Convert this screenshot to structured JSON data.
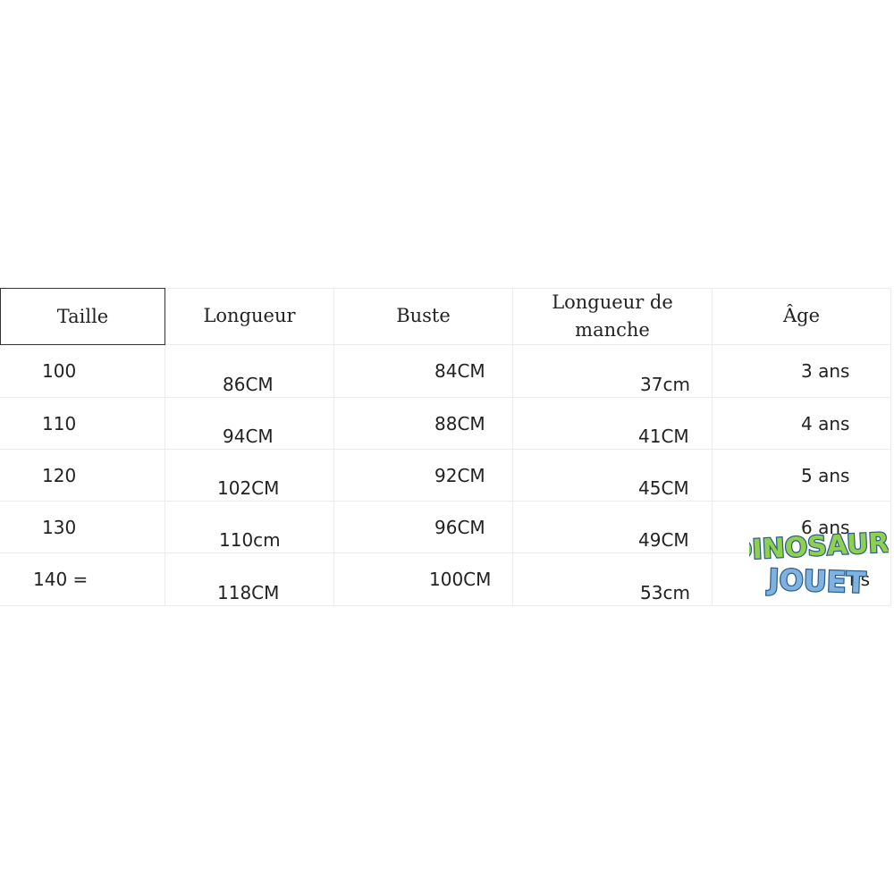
{
  "table": {
    "headers": {
      "taille": "Taille",
      "longueur": "Longueur",
      "buste": "Buste",
      "manche_line1": "Longueur de",
      "manche_line2": "manche",
      "age": "Âge"
    },
    "rows": [
      {
        "taille": "100",
        "longueur": "86CM",
        "buste": "84CM",
        "manche": "37cm",
        "age": "3 ans"
      },
      {
        "taille": "110",
        "longueur": "94CM",
        "buste": "88CM",
        "manche": "41CM",
        "age": "4 ans"
      },
      {
        "taille": "120",
        "longueur": "102CM",
        "buste": "92CM",
        "manche": "45CM",
        "age": "5 ans"
      },
      {
        "taille": "130",
        "longueur": "110cm",
        "buste": "96CM",
        "manche": "49CM",
        "age": "6 ans"
      },
      {
        "taille": "140 =",
        "longueur": "118CM",
        "buste": "100CM",
        "manche": "53cm",
        "age": "ns"
      }
    ]
  },
  "watermark": {
    "line1": "DINOSAURE",
    "line2": "JOUET",
    "colors": {
      "green": "#8fd14f",
      "blue": "#7fb2e0",
      "outline": "#2c5f8a"
    }
  }
}
